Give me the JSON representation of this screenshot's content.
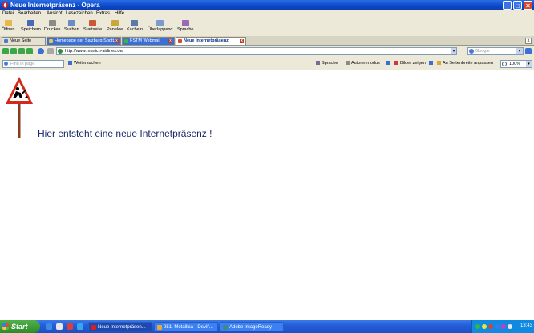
{
  "window": {
    "title": "Neue Internetpräsenz - Opera"
  },
  "menu": [
    "Datei",
    "Bearbeiten",
    "Ansicht",
    "Lesezeichen",
    "Extras",
    "Hilfe"
  ],
  "toolbar": [
    "Öffnen",
    "Speichern",
    "Drucken",
    "Suchen",
    "Startseite",
    "Panelee",
    "Kacheln",
    "Überlappend",
    "Sprache"
  ],
  "tabs": [
    {
      "label": "Neue Seite"
    },
    {
      "label": "Homepage der Salzburg Spott..."
    },
    {
      "label": "FSTM Webmail"
    },
    {
      "label": "Neue Internetpräsenz"
    }
  ],
  "address": {
    "url": "http://www.munich-airlines.de/"
  },
  "search": {
    "placeholder": "Google"
  },
  "findbar": {
    "placeholder": "Find in page",
    "next": "Weitersuchen",
    "sprache": "Sprache",
    "autoren": "Autorenmodus",
    "bilder": "Bilder zeigen",
    "anpassen": "An Seitenbreite anpassen",
    "zoom": "100%"
  },
  "page": {
    "heading": "Hier entsteht eine neue Internetpräsenz !"
  },
  "taskbar": {
    "start": "Start",
    "tasks": [
      "Neue Internetpräsen...",
      "251. Metallica - Devil'...",
      "Adobe ImageReady"
    ],
    "clock": "13:43"
  },
  "colors": {
    "titlebar": "#0a47c7",
    "taskbar": "#245edb",
    "start": "#3c9a36",
    "heading": "#1a2a6a",
    "sign_red": "#d42a1a",
    "sign_pole": "#8b3a1a"
  }
}
